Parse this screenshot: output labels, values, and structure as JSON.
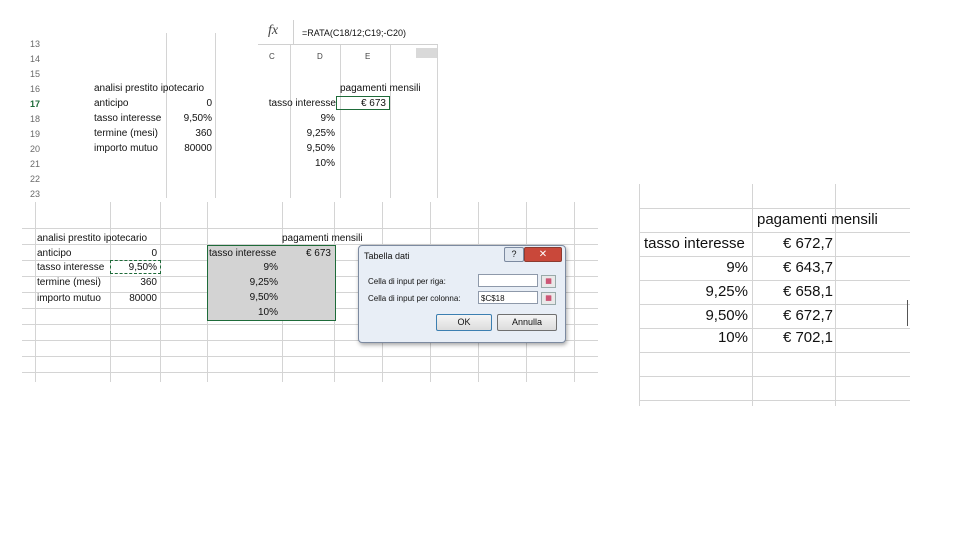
{
  "formula_bar": {
    "fx_icon": "fx",
    "formula": "=RATA(C18/12;C19;-C20)"
  },
  "panel1": {
    "col_headers": [
      "C",
      "D",
      "E"
    ],
    "row_numbers": [
      "13",
      "14",
      "15",
      "16",
      "17",
      "18",
      "19",
      "20",
      "21",
      "22",
      "23"
    ],
    "selected_row": "17",
    "left_title": "analisi prestito ipotecario",
    "left_rows": [
      {
        "label": "anticipo",
        "value": "0"
      },
      {
        "label": "tasso interesse",
        "value": "9,50%"
      },
      {
        "label": "termine (mesi)",
        "value": "360"
      },
      {
        "label": "importo mutuo",
        "value": "80000"
      }
    ],
    "right_title": "pagamenti mensili",
    "right_header_label": "tasso interesse",
    "right_header_value": "€ 673",
    "rates": [
      "9%",
      "9,25%",
      "9,50%",
      "10%"
    ]
  },
  "panel2": {
    "left_title": "analisi prestito ipotecario",
    "left_rows": [
      {
        "label": "anticipo",
        "value": "0"
      },
      {
        "label": "tasso interesse",
        "value": "9,50%"
      },
      {
        "label": "termine (mesi)",
        "value": "360"
      },
      {
        "label": "importo mutuo",
        "value": "80000"
      }
    ],
    "right_title": "pagamenti mensili",
    "right_header_label": "tasso interesse",
    "right_header_value": "€ 673",
    "rates": [
      "9%",
      "9,25%",
      "9,50%",
      "10%"
    ]
  },
  "dialog": {
    "title": "Tabella dati",
    "help_icon": "?",
    "close_icon": "✕",
    "row_label": "Cella di input per riga:",
    "row_value": "",
    "col_label": "Cella di input per colonna:",
    "col_value": "$C$18",
    "ok_label": "OK",
    "cancel_label": "Annulla"
  },
  "panel3": {
    "title": "pagamenti mensili",
    "header_label": "tasso interesse",
    "header_value": "€ 672,7",
    "rows": [
      {
        "rate": "9%",
        "payment": "€ 643,7"
      },
      {
        "rate": "9,25%",
        "payment": "€ 658,1"
      },
      {
        "rate": "9,50%",
        "payment": "€ 672,7"
      },
      {
        "rate": "10%",
        "payment": "€ 702,1"
      }
    ]
  }
}
